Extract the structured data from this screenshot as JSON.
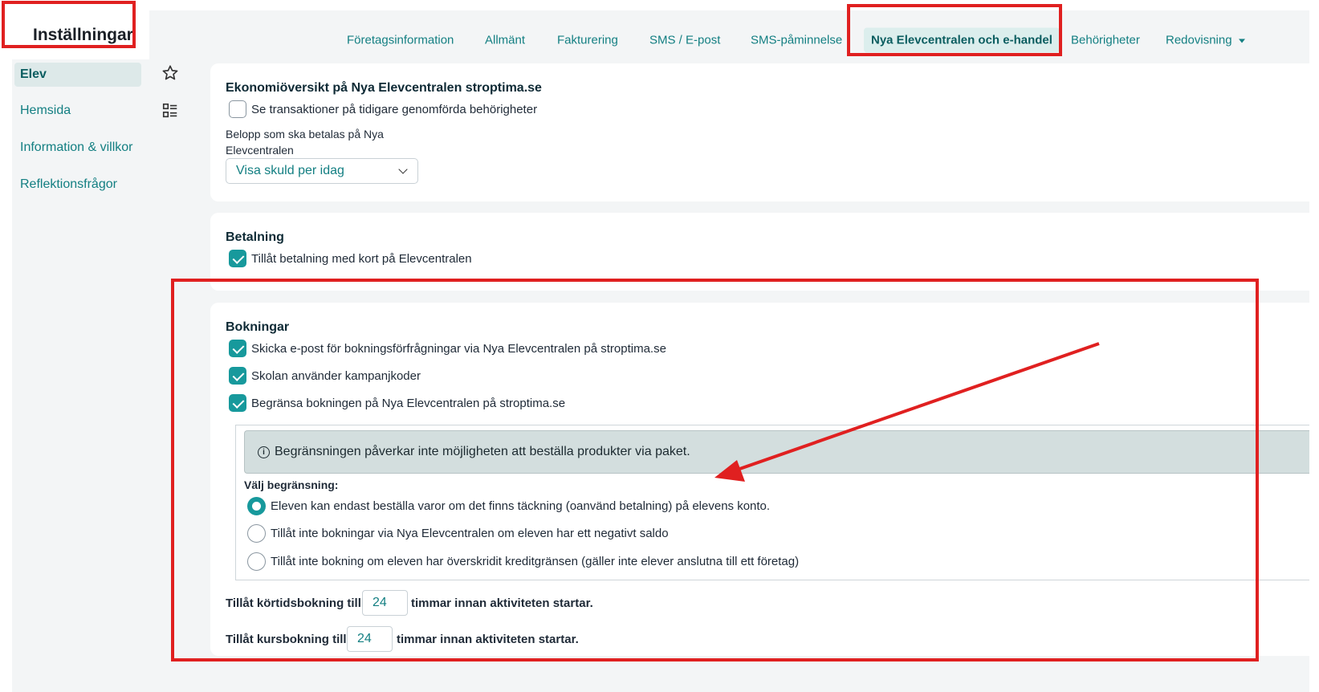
{
  "header": {
    "title": "Inställningar"
  },
  "nav": {
    "items": [
      "Företagsinformation",
      "Allmänt",
      "Fakturering",
      "SMS / E-post",
      "SMS-påminnelse",
      "Nya Elevcentralen och e-handel",
      "Behörigheter",
      "Redovisning"
    ],
    "active": "Nya Elevcentralen och e-handel"
  },
  "sidebar": {
    "items": [
      {
        "label": "Elev",
        "icon": "star-icon",
        "active": true
      },
      {
        "label": "Hemsida",
        "icon": "list-layout-icon",
        "active": false
      },
      {
        "label": "Information & villkor",
        "icon": "",
        "active": false
      },
      {
        "label": "Reflektionsfrågor",
        "icon": "",
        "active": false
      }
    ]
  },
  "economy": {
    "heading": "Ekonomiöversikt på Nya Elevcentralen stroptima.se",
    "checkbox_label": "Se transaktioner på tidigare genomförda behörigheter",
    "checkbox_checked": false,
    "amount_label": "Belopp som ska betalas på Nya Elevcentralen",
    "select_value": "Visa skuld per idag"
  },
  "payment": {
    "heading": "Betalning",
    "checkbox_label": "Tillåt betalning med kort på Elevcentralen",
    "checkbox_checked": true
  },
  "bookings": {
    "heading": "Bokningar",
    "checkboxes": [
      {
        "label": "Skicka e-post för bokningsförfrågningar via Nya Elevcentralen på stroptima.se",
        "checked": true
      },
      {
        "label": "Skolan använder kampanjkoder",
        "checked": true
      },
      {
        "label": "Begränsa bokningen på Nya Elevcentralen på stroptima.se",
        "checked": true
      }
    ],
    "info_text": "Begränsningen påverkar inte möjligheten att beställa produkter via paket.",
    "restriction_label": "Välj begränsning:",
    "radios": [
      {
        "label": "Eleven kan endast beställa varor om det finns täckning (oanvänd betalning) på elevens konto.",
        "selected": true
      },
      {
        "label": "Tillåt inte bokningar via Nya Elevcentralen om eleven har ett negativt saldo",
        "selected": false
      },
      {
        "label": "Tillåt inte bokning om eleven har överskridit kreditgränsen (gäller inte elever anslutna till ett företag)",
        "selected": false
      }
    ],
    "short_booking": {
      "prefix": "Tillåt körtidsbokning till",
      "value": "24",
      "suffix": "timmar innan aktiviteten startar."
    },
    "course_booking": {
      "prefix": "Tillåt kursbokning till",
      "value": "24",
      "suffix": "timmar innan aktiviteten startar."
    }
  },
  "colors": {
    "accent": "#17999c",
    "link": "#137f82",
    "annotation": "#e02020"
  }
}
